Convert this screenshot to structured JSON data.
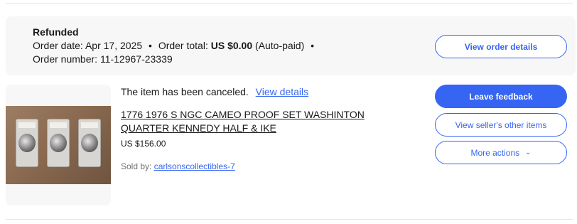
{
  "order": {
    "status": "Refunded",
    "date_label": "Order date:",
    "date": "Apr 17, 2025",
    "total_label": "Order total:",
    "total": "US $0.00",
    "payment_note": "(Auto-paid)",
    "number_label": "Order number:",
    "number": "11-12967-23339",
    "separator": "•",
    "view_order_label": "View order details"
  },
  "item": {
    "cancel_message": "The item has been canceled.",
    "view_details_label": "View details",
    "title": "1776 1976 S NGC CAMEO PROOF SET WASHINTON QUARTER KENNEDY HALF & IKE",
    "price": "US $156.00",
    "sold_by_label": "Sold by:",
    "seller": "carlsonscollectibles-7"
  },
  "actions": {
    "leave_feedback": "Leave feedback",
    "view_seller_items": "View seller's other items",
    "more_actions": "More actions",
    "more_actions_icon": "chevron-down-icon"
  },
  "colors": {
    "accent": "#3665f3",
    "header_bg": "#f7f7f7"
  }
}
